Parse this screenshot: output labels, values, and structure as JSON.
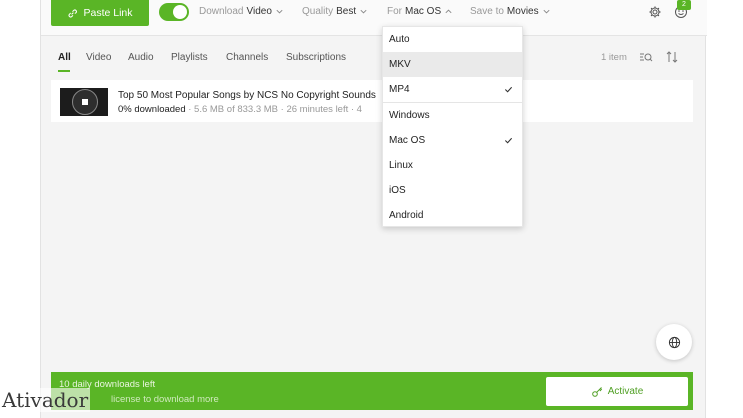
{
  "toolbar": {
    "paste_label": "Paste Link",
    "download_label": "Download",
    "download_value": "Video",
    "quality_label": "Quality",
    "quality_value": "Best",
    "for_label": "For",
    "for_value": "Mac OS",
    "save_label": "Save to",
    "save_value": "Movies",
    "badge": "2"
  },
  "tabs": [
    "All",
    "Video",
    "Audio",
    "Playlists",
    "Channels",
    "Subscriptions"
  ],
  "item_count": "1 item",
  "download": {
    "title": "Top 50 Most Popular Songs by NCS   No Copyright Sounds",
    "progress": "0% downloaded",
    "size": " · 5.6 MB of 833.3 MB · 26 minutes left · 4"
  },
  "dropdown": {
    "options": [
      "Auto",
      "MKV",
      "MP4",
      "Windows",
      "Mac OS",
      "Linux",
      "iOS",
      "Android"
    ],
    "highlighted": "MKV",
    "checked": [
      "MP4",
      "Mac OS"
    ]
  },
  "bottom": {
    "line1": "10 daily downloads left",
    "line2": "license to download more",
    "activate": "Activate"
  },
  "watermark": "Ativador",
  "colors": {
    "accent": "#5ab526"
  }
}
